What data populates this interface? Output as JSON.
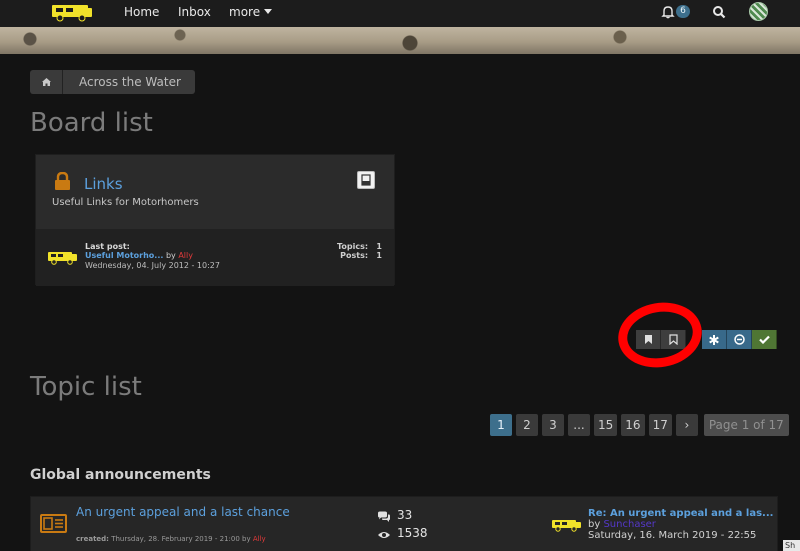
{
  "nav": {
    "items": [
      "Home",
      "Inbox",
      "more"
    ],
    "notification_count": "6"
  },
  "breadcrumb": {
    "current": "Across the Water"
  },
  "board_list": {
    "heading": "Board list",
    "board": {
      "title": "Links",
      "description": "Useful Links for Motorhomers",
      "last_post_label": "Last post:",
      "last_post_link": "Useful Motorho...",
      "last_post_by": "by",
      "last_post_user": "Ally",
      "last_post_date": "Wednesday, 04. July 2012 - 10:27",
      "topics_label": "Topics:",
      "topics_value": "1",
      "posts_label": "Posts:",
      "posts_value": "1"
    }
  },
  "topic_list": {
    "heading": "Topic list",
    "pages": [
      "1",
      "2",
      "3",
      "...",
      "15",
      "16",
      "17",
      "›"
    ],
    "page_info": "Page 1 of 17",
    "global_heading": "Global announcements",
    "announcement": {
      "title": "An urgent appeal and a last chance",
      "created_label": "created:",
      "created_date": "Thursday, 28. February 2019 - 21:00",
      "created_by": "by",
      "created_user": "Ally",
      "replies": "33",
      "views": "1538",
      "last_title": "Re: An urgent appeal and a las...",
      "last_by": "by",
      "last_user": "Sunchaser",
      "last_date": "Saturday, 16. March 2019 - 22:55"
    }
  },
  "share_label": "Sh",
  "colors": {
    "accent": "#5ca0dd",
    "primary_button": "#38698a",
    "success_button": "#4f7634",
    "highlight_circle": "#ff0000",
    "logo_yellow": "#f1e22a"
  }
}
